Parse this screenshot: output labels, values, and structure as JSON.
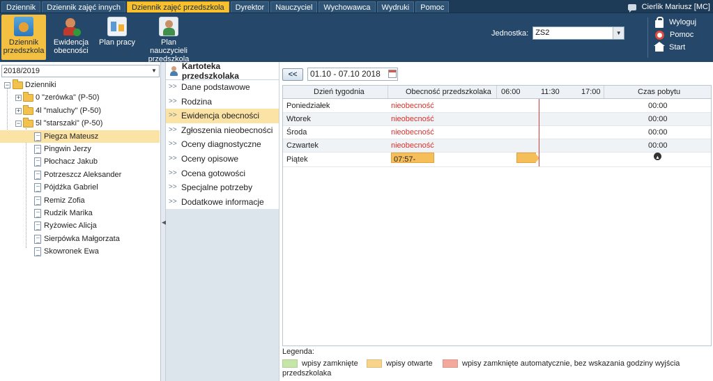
{
  "topnav": {
    "tabs": [
      "Dziennik",
      "Dziennik zajęć innych",
      "Dziennik zajęć przedszkola",
      "Dyrektor",
      "Nauczyciel",
      "Wychowawca",
      "Wydruki",
      "Pomoc"
    ],
    "active_tab": "Dziennik zajęć przedszkola",
    "user": "Cierlik Mariusz [MC]"
  },
  "toolbar": {
    "items": [
      {
        "label": "Dziennik przedszkola",
        "active": true
      },
      {
        "label": "Ewidencja obecności",
        "active": false
      },
      {
        "label": "Plan pracy",
        "active": false
      },
      {
        "label": "Plan nauczycieli przedszkola",
        "active": false
      }
    ],
    "unit_label": "Jednostka:",
    "unit_value": "ZS2",
    "links": [
      "Wyloguj",
      "Pomoc",
      "Start"
    ]
  },
  "tree": {
    "year": "2018/2019",
    "root": "Dzienniki",
    "groups": [
      "0 \"zerówka\" (P-50)",
      "4l \"maluchy\" (P-50)",
      "5l \"starszaki\" (P-50)"
    ],
    "children": [
      "Piegza Mateusz",
      "Pingwin Jerzy",
      "Płochacz Jakub",
      "Potrzeszcz Aleksander",
      "Pójdźka Gabriel",
      "Remiz Zofia",
      "Rudzik Marika",
      "Ryżowiec Alicja",
      "Sierpówka Małgorzata",
      "Skowronek Ewa"
    ],
    "selected": "Piegza Mateusz"
  },
  "menu": {
    "title": "Kartoteka przedszkolaka",
    "items": [
      "Dane podstawowe",
      "Rodzina",
      "Ewidencja obecności",
      "Zgłoszenia nieobecności",
      "Oceny diagnostyczne",
      "Oceny opisowe",
      "Ocena gotowości",
      "Specjalne potrzeby",
      "Dodatkowe informacje"
    ],
    "active": "Ewidencja obecności"
  },
  "week": {
    "prev": "<<",
    "range": "01.10 - 07.10 2018"
  },
  "table": {
    "headers": {
      "day": "Dzień tygodnia",
      "presence": "Obecność przedszkolaka",
      "t1": "06:00",
      "t2": "11:30",
      "t3": "17:00",
      "time": "Czas pobytu"
    },
    "rows": [
      {
        "day": "Poniedziałek",
        "presence": "nieobecność",
        "time": "00:00"
      },
      {
        "day": "Wtorek",
        "presence": "nieobecność",
        "time": "00:00"
      },
      {
        "day": "Środa",
        "presence": "nieobecność",
        "time": "00:00"
      },
      {
        "day": "Czwartek",
        "presence": "nieobecność",
        "time": "00:00"
      },
      {
        "day": "Piątek",
        "presence": "07:57-",
        "time": ""
      }
    ]
  },
  "legend": {
    "title": "Legenda:",
    "items": [
      {
        "label": "wpisy zamknięte",
        "color": "#c5e6a6"
      },
      {
        "label": "wpisy otwarte",
        "color": "#f8d38a"
      },
      {
        "label": "wpisy zamknięte automatycznie, bez wskazania godziny wyjścia",
        "color": "#f4a79c"
      }
    ],
    "wrap": "przedszkolaka"
  },
  "colors": {
    "nav": "#1d3b57",
    "toolbar": "#25476a",
    "accent": "#f6c02f",
    "absent": "#d9302b",
    "selected_row": "#fbe3a6"
  }
}
